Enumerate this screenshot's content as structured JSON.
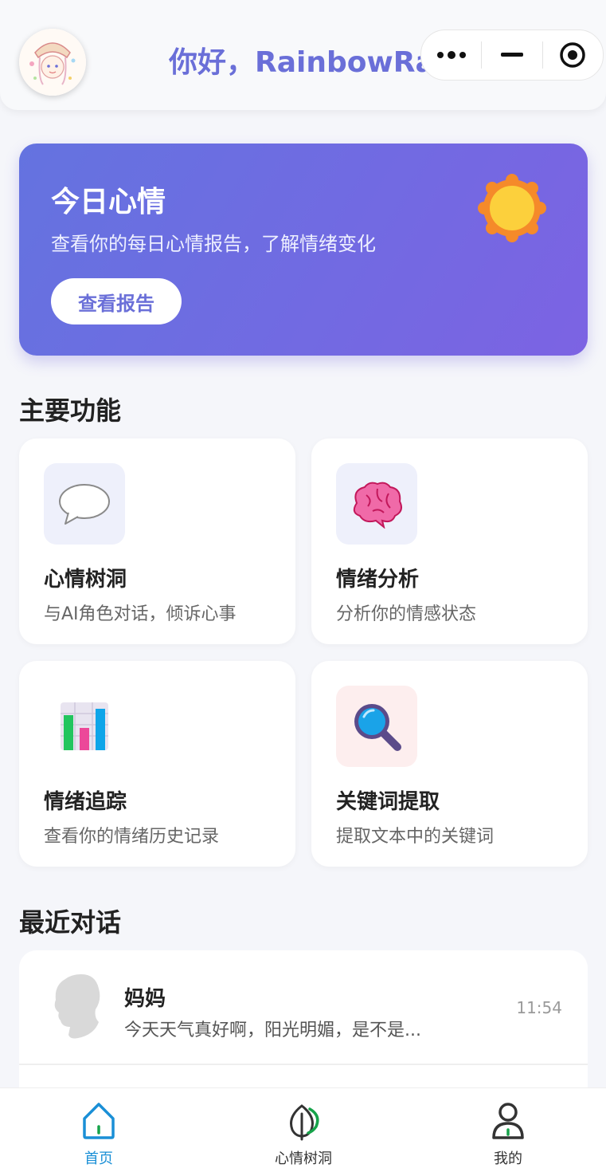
{
  "header": {
    "greeting": "你好，RainbowRain",
    "capsule": {
      "more_icon": "more-dots-icon",
      "minimize_icon": "minimize-icon",
      "close_icon": "target-circle-icon"
    }
  },
  "banner": {
    "title": "今日心情",
    "subtitle": "查看你的每日心情报告，了解情绪变化",
    "button_label": "查看报告",
    "icon": "sun-icon"
  },
  "features": {
    "section_title": "主要功能",
    "items": [
      {
        "title": "心情树洞",
        "desc": "与AI角色对话，倾诉心事",
        "icon": "speech-bubble-icon",
        "bg": "#eef0fb"
      },
      {
        "title": "情绪分析",
        "desc": "分析你的情感状态",
        "icon": "brain-icon",
        "bg": "#eef0fb"
      },
      {
        "title": "情绪追踪",
        "desc": "查看你的情绪历史记录",
        "icon": "bar-chart-icon",
        "bg": "#ffffff"
      },
      {
        "title": "关键词提取",
        "desc": "提取文本中的关键词",
        "icon": "magnifier-icon",
        "bg": "#fdeeee"
      }
    ]
  },
  "recent": {
    "section_title": "最近对话",
    "items": [
      {
        "name": "妈妈",
        "message": "今天天气真好啊，阳光明媚，是不是...",
        "time": "11:54"
      }
    ]
  },
  "tabbar": {
    "items": [
      {
        "label": "首页",
        "icon": "home-icon",
        "active": true
      },
      {
        "label": "心情树洞",
        "icon": "leaf-icon",
        "active": false
      },
      {
        "label": "我的",
        "icon": "user-icon",
        "active": false
      }
    ],
    "active_color": "#1a8fd6"
  },
  "colors": {
    "accent": "#6a6fd8",
    "banner_start": "#6473e0",
    "banner_end": "#7c63e3"
  }
}
